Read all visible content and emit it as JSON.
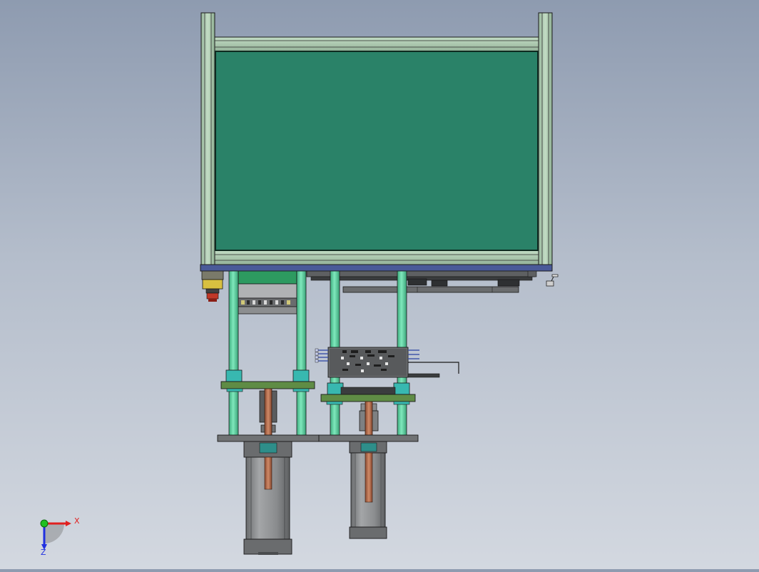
{
  "viewport": {
    "background_top": "#8e9bb0",
    "background_bottom": "#d3d8e0"
  },
  "colors": {
    "panel_fill": "#2a8268",
    "frame_profile": "#a8c8ab",
    "guide_rod": "#5fd0a0",
    "bushing": "#38b8b0",
    "plate_green": "#5f8c45",
    "base_plate": "#707274",
    "cylinder_body": "#8a8c8e",
    "piston_rod": "#b0684a",
    "base_rail": "#4a5a98",
    "sensor_yellow": "#d8c040",
    "sensor_red": "#c03828"
  },
  "triad": {
    "x_label": "X",
    "z_label": "Z",
    "x_axis_color": "#e02020",
    "y_axis_color": "#20c020",
    "z_axis_color": "#2030e0"
  }
}
